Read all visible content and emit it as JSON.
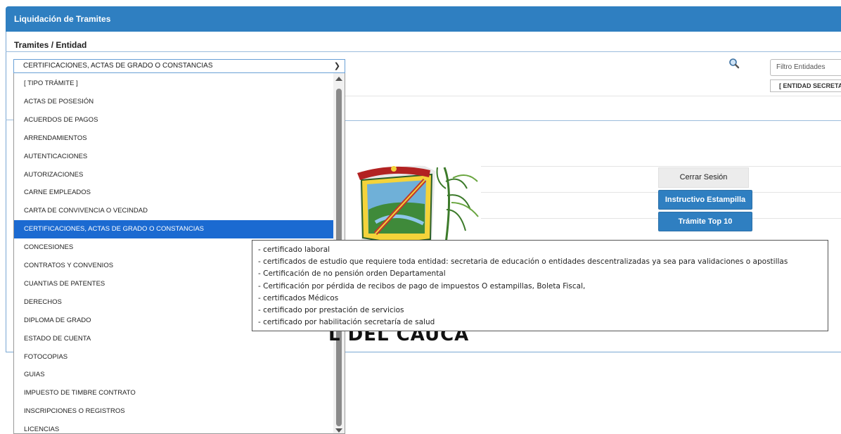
{
  "header": {
    "title": "Liquidación de Tramites"
  },
  "section": {
    "label": "Tramites / Entidad"
  },
  "tramite_select": {
    "selected": "CERTIFICACIONES, ACTAS DE GRADO O CONSTANCIAS",
    "options": [
      "[ TIPO TRÁMITE ]",
      "ACTAS DE POSESIÓN",
      "ACUERDOS DE PAGOS",
      "ARRENDAMIENTOS",
      "AUTENTICACIONES",
      "AUTORIZACIONES",
      "CARNE EMPLEADOS",
      "CARTA DE CONVIVENCIA O VECINDAD",
      "CERTIFICACIONES, ACTAS DE GRADO O CONSTANCIAS",
      "CONCESIONES",
      "CONTRATOS Y CONVENIOS",
      "CUANTIAS DE PATENTES",
      "DERECHOS",
      "DIPLOMA DE GRADO",
      "ESTADO DE CUENTA",
      "FOTOCOPIAS",
      "GUIAS",
      "IMPUESTO DE TIMBRE CONTRATO",
      "INSCRIPCIONES O REGISTROS",
      "LICENCIAS"
    ],
    "selected_index": 8
  },
  "filtro": {
    "placeholder": "Filtro Entidades"
  },
  "entidad_select": {
    "selected": "[ ENTIDAD SECRETARIA ]"
  },
  "buttons": {
    "cerrar": "Cerrar Sesión",
    "instructivo": "Instructivo Estampilla",
    "top10": "Trámite Top 10"
  },
  "tooltip": {
    "lines": [
      "- certificado laboral",
      "- certificados de estudio que requiere toda entidad: secretaria de educación o entidades descentralizadas ya sea para validaciones o apostillas",
      "- Certificación de no pensión orden Departamental",
      " - Certificación por pérdida de recibos de pago de impuestos O estampillas, Boleta Fiscal,",
      " - certificados Médicos",
      " - certificado por prestación de servicios",
      " - certificado por habilitación secretaría de salud"
    ]
  },
  "bottom_title": "L DEL CAUCA",
  "colors": {
    "primary": "#2f7fc1",
    "selected": "#1b6ad1"
  }
}
